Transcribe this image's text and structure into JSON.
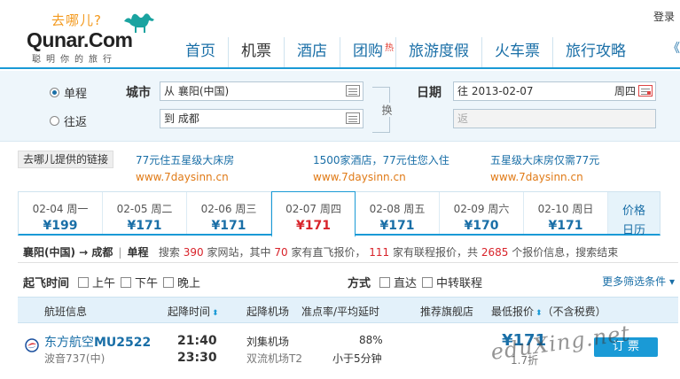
{
  "header": {
    "logo_cn": "去哪儿?",
    "logo_en": "Qunar.Com",
    "slogan": "聪明你的旅行",
    "login": "登录",
    "nav": [
      "首页",
      "机票",
      "酒店",
      "团购",
      "旅游度假",
      "火车票",
      "旅行攻略"
    ],
    "nav_active": "机票",
    "hot_badge": "热",
    "nav_more": "《"
  },
  "search": {
    "trip_type": {
      "one_way": "单程",
      "round_trip": "往返",
      "selected": "单程"
    },
    "city_label": "城市",
    "from_value": "从 襄阳(中国)",
    "to_value": "到 成都",
    "swap_label": "换",
    "date_label": "日期",
    "depart_value": "往 2013-02-07",
    "depart_weekday": "周四",
    "return_placeholder": "返"
  },
  "ads": {
    "label": "去哪儿提供的链接",
    "items": [
      {
        "title": "77元住五星级大床房",
        "url": "www.7daysinn.cn"
      },
      {
        "title": "1500家酒店，77元住您入住",
        "url": "www.7daysinn.cn"
      },
      {
        "title": "五星级大床房仅需77元",
        "url": "www.7daysinn.cn"
      }
    ]
  },
  "dates": [
    {
      "date": "02-04 周一",
      "price": "¥199"
    },
    {
      "date": "02-05 周二",
      "price": "¥171"
    },
    {
      "date": "02-06 周三",
      "price": "¥171"
    },
    {
      "date": "02-07 周四",
      "price": "¥171",
      "active": true
    },
    {
      "date": "02-08 周五",
      "price": "¥171"
    },
    {
      "date": "02-09 周六",
      "price": "¥170"
    },
    {
      "date": "02-10 周日",
      "price": "¥171"
    }
  ],
  "calendar_tab": {
    "line1": "价格",
    "line2": "日历"
  },
  "summary": {
    "route": "襄阳(中国) → 成都",
    "trip": "单程",
    "t1": "搜索",
    "sites": "390",
    "t2": "家网站，其中",
    "direct": "70",
    "t3": "家有直飞报价，",
    "combo": "111",
    "t4": "家有联程报价，共",
    "quotes": "2685",
    "t5": "个报价信息，搜索结束"
  },
  "filters": {
    "time_label": "起飞时间",
    "times": [
      "上午",
      "下午",
      "晚上"
    ],
    "mode_label": "方式",
    "modes": [
      "直达",
      "中转联程"
    ],
    "more": "更多筛选条件 ▾"
  },
  "table_header": {
    "flight_info": "航班信息",
    "times": "起降时间",
    "airports": "起降机场",
    "punctuality": "准点率/平均延时",
    "flagship": "推荐旗舰店",
    "lowest": "最低报价",
    "tax_note": "（不含税费）"
  },
  "flight": {
    "airline": "东方航空",
    "flight_no": "MU2522",
    "aircraft": "波音737(中)",
    "depart_time": "21:40",
    "arrive_time": "23:30",
    "depart_airport": "刘集机场",
    "arrive_airport": "双流机场T2",
    "on_time_rate": "88%",
    "avg_delay": "小于5分钟",
    "price": "¥171",
    "discount": "1.7折",
    "book_label": "订 票"
  },
  "watermark": "eduXing.net",
  "colors": {
    "brand_blue": "#1a9ad6",
    "link_blue": "#1a6fa7",
    "price_red": "#d8232a",
    "ad_orange": "#e07a16"
  }
}
